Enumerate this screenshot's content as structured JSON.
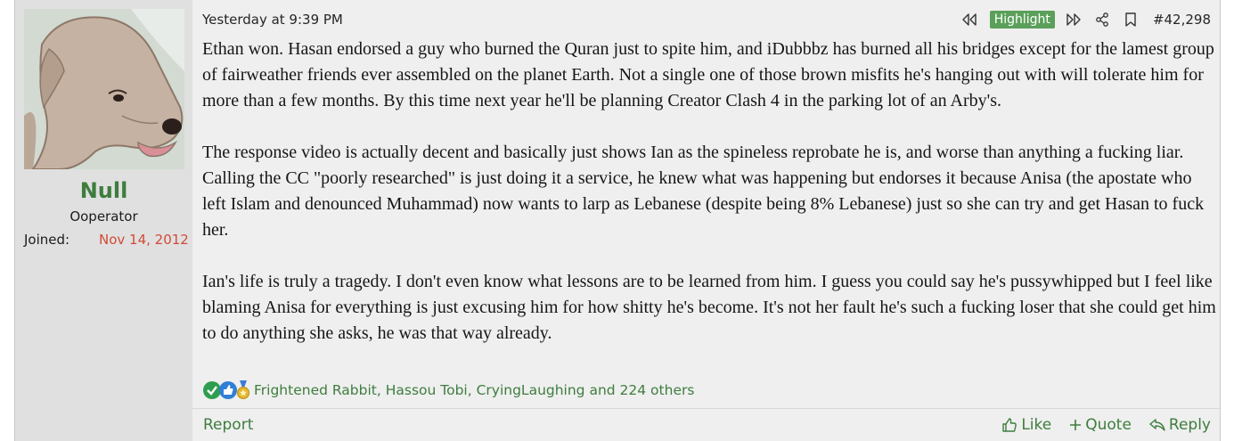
{
  "user": {
    "name": "Null",
    "title": "Ooperator",
    "joined_label": "Joined:",
    "joined_value": "Nov 14, 2012"
  },
  "post": {
    "timestamp": "Yesterday at 9:39 PM",
    "highlight_label": "Highlight",
    "number": "#42,298",
    "paragraphs": [
      "Ethan won. Hasan endorsed a guy who burned the Quran just to spite him, and iDubbbz has burned all his bridges except for the lamest group of fairweather friends ever assembled on the planet Earth. Not a single one of those brown misfits he's hanging out with will tolerate him for more than a few months. By this time next year he'll be planning Creator Clash 4 in the parking lot of an Arby's.",
      "The response video is actually decent and basically just shows Ian as the spineless reprobate he is, and worse than anything a fucking liar. Calling the CC \"poorly researched\" is just doing it a service, he knew what was happening but endorses it because Anisa (the apostate who left Islam and denounced Muhammad) now wants to larp as Lebanese (despite being 8% Lebanese) just so she can try and get Hasan to fuck her.",
      "Ian's life is truly a tragedy. I don't even know what lessons are to be learned from him. I guess you could say he's pussywhipped but I feel like blaming Anisa for everything is just excusing him for how shitty he's become. It's not her fault he's such a fucking loser that she could get him to do anything she asks, he was that way already."
    ]
  },
  "reactions": {
    "icons": [
      "check-reaction-icon",
      "thumbs-up-reaction-icon",
      "medal-reaction-icon"
    ],
    "user1": "Frightened Rabbit",
    "user2": "Hassou Tobi",
    "user3": "CryingLaughing",
    "sep1": ", ",
    "sep2": ", ",
    "others": " and 224 others"
  },
  "footer": {
    "report": "Report",
    "like": "Like",
    "quote": "Quote",
    "reply": "Reply"
  },
  "colors": {
    "accent": "#3e7d3e",
    "highlight_badge": "#5aa05a",
    "joined_date": "#d14b37",
    "user_column": "#e0e0e0",
    "post_background": "#efefef"
  }
}
